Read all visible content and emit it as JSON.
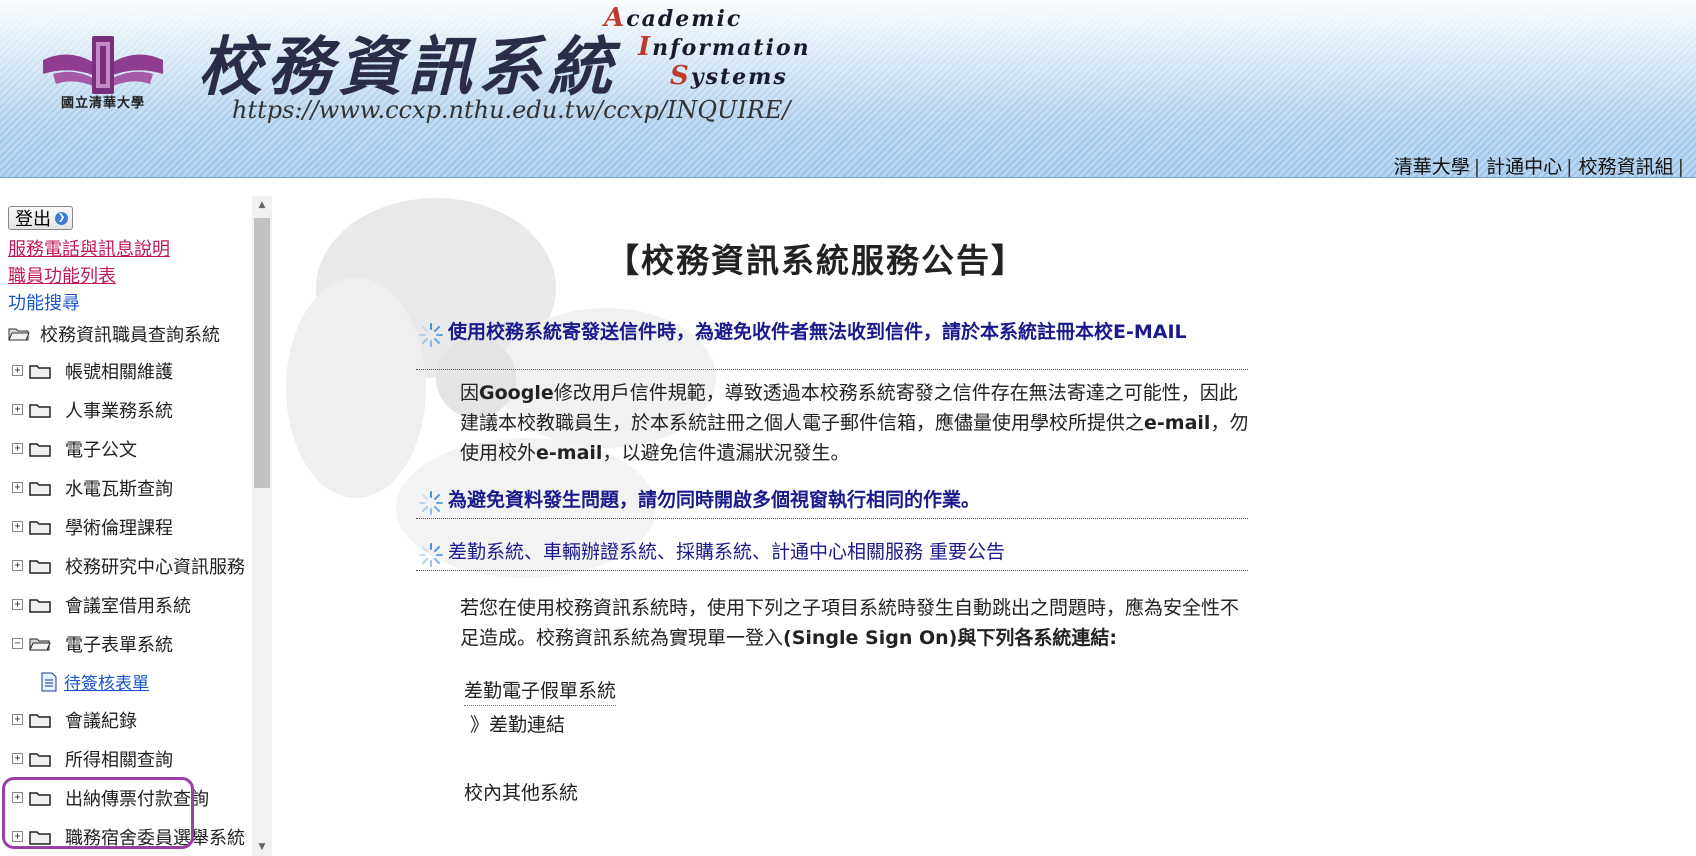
{
  "header": {
    "university_name": "國立清華大學",
    "system_title": "校務資訊系統",
    "system_url": "https://www.ccxp.nthu.edu.tw/ccxp/INQUIRE/",
    "english_title": {
      "line1_cap": "A",
      "line1_rest": "cademic",
      "line2_cap": "I",
      "line2_rest": "nformation",
      "line3_cap": "S",
      "line3_rest": "ystems"
    },
    "links": [
      "清華大學",
      "計通中心",
      "校務資訊組"
    ],
    "separator": "|"
  },
  "sidebar": {
    "logout_label": "登出",
    "top_links": [
      {
        "label": "服務電話與訊息說明"
      },
      {
        "label": "職員功能列表"
      },
      {
        "label": "功能搜尋"
      }
    ],
    "tree_root": "校務資訊職員查詢系統",
    "items": [
      {
        "label": "帳號相關維護",
        "expanded": false
      },
      {
        "label": "人事業務系統",
        "expanded": false
      },
      {
        "label": "電子公文",
        "expanded": false
      },
      {
        "label": "水電瓦斯查詢",
        "expanded": false
      },
      {
        "label": "學術倫理課程",
        "expanded": false
      },
      {
        "label": "校務研究中心資訊服務",
        "expanded": false
      },
      {
        "label": "會議室借用系統",
        "expanded": false
      },
      {
        "label": "電子表單系統",
        "expanded": true,
        "children": [
          {
            "label": "待簽核表單"
          }
        ]
      },
      {
        "label": "會議紀錄",
        "expanded": false
      },
      {
        "label": "所得相關查詢",
        "expanded": false
      },
      {
        "label": "出納傳票付款查詢",
        "expanded": false
      },
      {
        "label": "職務宿舍委員選舉系統",
        "expanded": false
      }
    ]
  },
  "main": {
    "title": "【校務資訊系統服務公告】",
    "announcements": [
      {
        "headline": "使用校務系統寄發送信件時，為避免收件者無法收到信件，請於本系統註冊本校E-MAIL",
        "body_parts": [
          "因",
          "Google",
          "修改用戶信件規範，導致透過本校務系統寄發之信件存在無法寄達之可能性，因此建議本校教職員生，於本系統註冊之個人電子郵件信箱，應儘量使用學校所提供之",
          "e-mail",
          "，勿使用校外",
          "e-mail",
          "，以避免信件遺漏狀況發生。"
        ]
      },
      {
        "headline": "為避免資料發生問題，請勿同時開啟多個視窗執行相同的作業。"
      },
      {
        "headline": "差勤系統、車輛辦證系統、採購系統、計通中心相關服務 重要公告",
        "body_parts": [
          "若您在使用校務資訊系統時，使用下列之子項目系統時發生自動跳出之問題時，應為安全性不足造成。校務資訊系統為實現單一登入",
          "(Single Sign On)",
          "與下列各系統連結:"
        ],
        "sub_section_title": "差勤電子假單系統",
        "sub_link": "》差勤連結",
        "next_section_title": "校內其他系統"
      }
    ]
  },
  "colors": {
    "header_stripe": "#9cc3e8",
    "link_pink": "#c2185b",
    "link_blue": "#1a56c9",
    "headline_navy": "#1a1a8c",
    "highlight_purple": "#9b3fa6"
  }
}
